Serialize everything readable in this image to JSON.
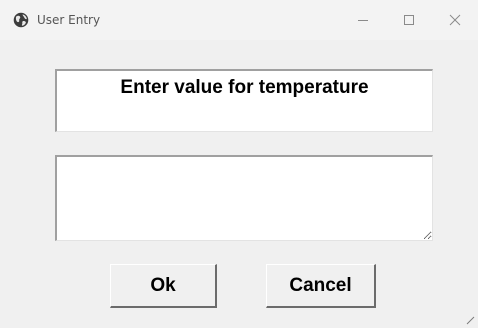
{
  "window": {
    "title": "User Entry",
    "app_icon": "globe-icon",
    "minimize_icon": "minimize-icon",
    "maximize_icon": "maximize-icon",
    "close_icon": "close-icon"
  },
  "dialog": {
    "prompt": "Enter value for temperature",
    "input_value": "",
    "ok_label": "Ok",
    "cancel_label": "Cancel"
  },
  "colors": {
    "background": "#f0f0f0",
    "field_background": "#ffffff",
    "text": "#000000",
    "title_text": "#555555"
  }
}
